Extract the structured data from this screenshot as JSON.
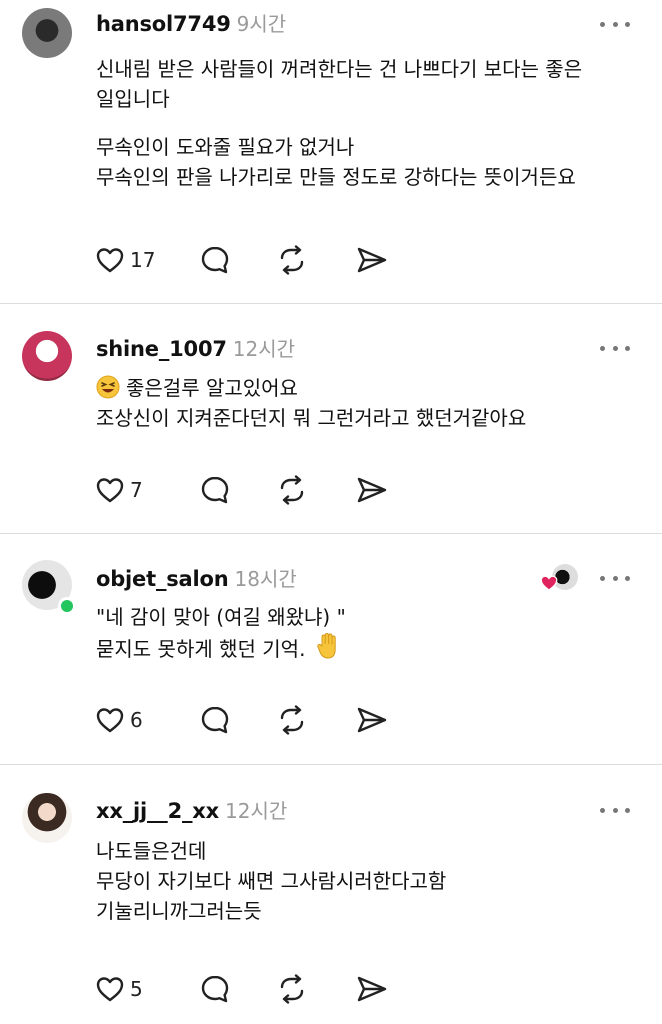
{
  "posts": [
    {
      "username": "hansol7749",
      "time": "9시간",
      "avatar_icon": "profile-photo",
      "lines": [
        "신내림 받은 사람들이 꺼려한다는 건 나쁘다기 보다는 좋은",
        "일입니다",
        "",
        "무속인이 도와줄 필요가 없거나",
        "무속인의 판을 나가리로 만들 정도로 강하다는 뜻이거든요"
      ],
      "likes": "17"
    },
    {
      "username": "shine_1007",
      "time": "12시간",
      "avatar_icon": "profile-photo",
      "lines": [
        "좋은걸루 알고있어요",
        "조상신이 지켜준다던지 뭐 그런거라고 했던거같아요"
      ],
      "likes": "7"
    },
    {
      "username": "objet_salon",
      "time": "18시간",
      "avatar_icon": "profile-photo",
      "lines": [
        "\"네 감이 맞아 (여길 왜왔냐) \"",
        "묻지도 못하게 했던 기억."
      ],
      "likes": "6"
    },
    {
      "username": "xx_jj__2_xx",
      "time": "12시간",
      "avatar_icon": "profile-photo",
      "lines": [
        "나도들은건데",
        "무당이 자기보다 쌔면 그사람시러한다고함",
        "기눌리니까그러는듯"
      ],
      "likes": "5"
    }
  ],
  "icons": {
    "like": "heart-icon",
    "reply": "comment-bubble-icon",
    "repost": "repost-icon",
    "share": "send-icon",
    "more": "more-dots-icon",
    "laugh_emoji": "grinning-squint-emoji",
    "hand_emoji": "raised-hand-emoji",
    "author_liked": "author-liked-heart-icon"
  },
  "colors": {
    "text": "#111111",
    "meta": "#9a9a9a",
    "online": "#22c55e",
    "liked_heart": "#e0245e"
  }
}
